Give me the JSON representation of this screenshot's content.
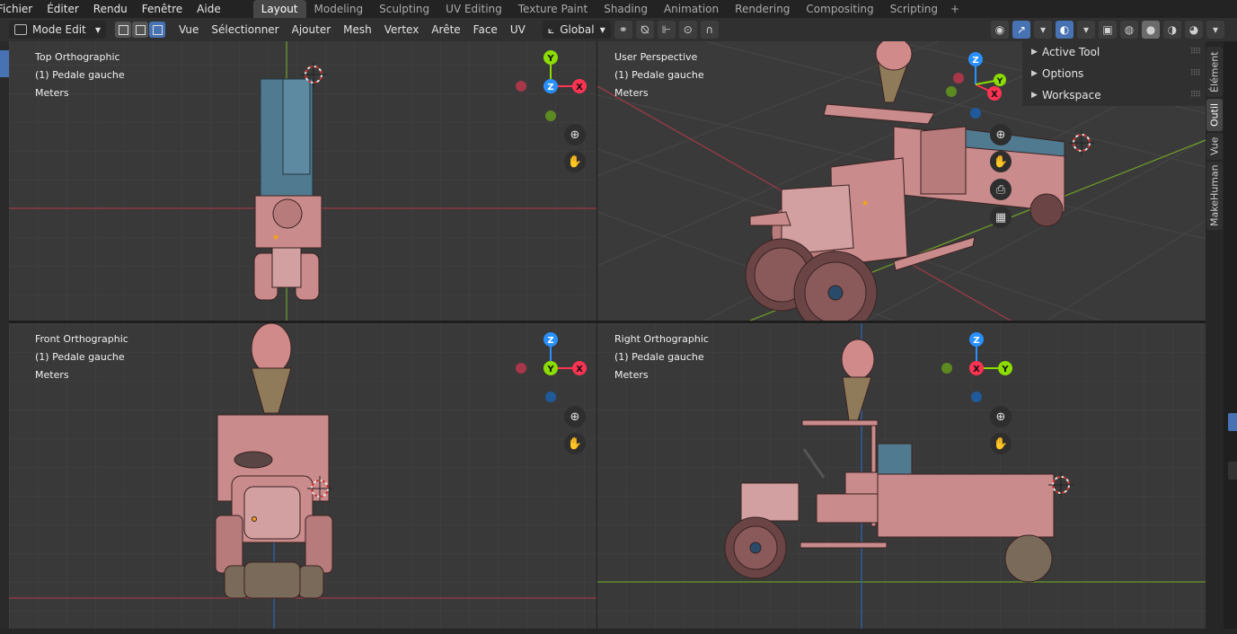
{
  "menu": [
    "Fichier",
    "Éditer",
    "Rendu",
    "Fenêtre",
    "Aide"
  ],
  "workspace_tabs": [
    "Layout",
    "Modeling",
    "Sculpting",
    "UV Editing",
    "Texture Paint",
    "Shading",
    "Animation",
    "Rendering",
    "Compositing",
    "Scripting"
  ],
  "active_tab": "Layout",
  "header": {
    "mode": "Mode Edit",
    "menus": [
      "Vue",
      "Sélectionner",
      "Ajouter",
      "Mesh",
      "Vertex",
      "Arête",
      "Face",
      "UV"
    ],
    "orientation": "Global"
  },
  "viewports": {
    "top": {
      "view": "Top Orthographic",
      "object": "(1) Pedale gauche",
      "units": "Meters"
    },
    "user": {
      "view": "User Perspective",
      "object": "(1) Pedale gauche",
      "units": "Meters"
    },
    "front": {
      "view": "Front Orthographic",
      "object": "(1) Pedale gauche",
      "units": "Meters"
    },
    "right": {
      "view": "Right Orthographic",
      "object": "(1) Pedale gauche",
      "units": "Meters"
    }
  },
  "gizmo_axes": {
    "x": "X",
    "y": "Y",
    "z": "Z"
  },
  "npanel": {
    "items": [
      "Active Tool",
      "Options",
      "Workspace"
    ]
  },
  "side_tabs": [
    "Élément",
    "Outil",
    "Vue",
    "MakeHuman"
  ],
  "colors": {
    "accent": "#4772b3",
    "axis_x": "#ff3352",
    "axis_y": "#8bdc00",
    "axis_z": "#2890ff",
    "model_pink": "#c98b8b",
    "model_blue": "#4f7a8f"
  }
}
